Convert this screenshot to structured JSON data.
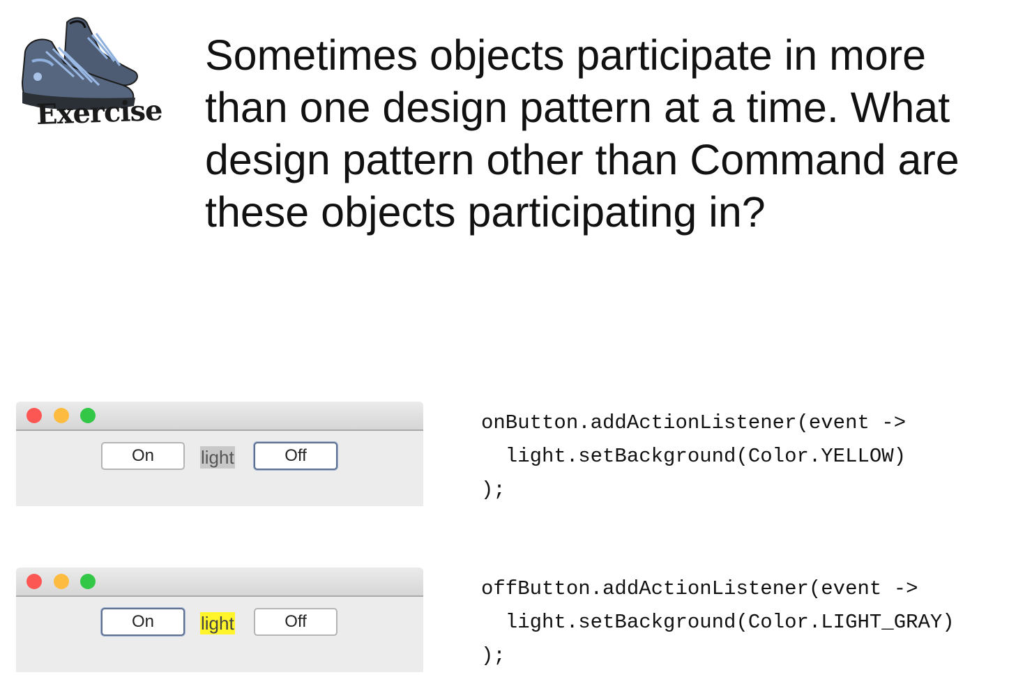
{
  "exercise": {
    "label": "Exercise",
    "icon": "sneakers-icon"
  },
  "question": "Sometimes objects participate in more than one design pattern at a time. What design pattern other than Command are these objects participating in?",
  "windows": [
    {
      "buttons": {
        "on": "On",
        "off": "Off"
      },
      "focused": "off",
      "light": {
        "text": "light",
        "background": "#c8c8c8"
      }
    },
    {
      "buttons": {
        "on": "On",
        "off": "Off"
      },
      "focused": "on",
      "light": {
        "text": "light",
        "background": "#fff52a"
      }
    }
  ],
  "colors": {
    "traffic_red": "#fc5753",
    "traffic_yellow": "#fdbc40",
    "traffic_green": "#33c748"
  },
  "code_snippets": [
    "onButton.addActionListener(event ->\n  light.setBackground(Color.YELLOW)\n);",
    "offButton.addActionListener(event ->\n  light.setBackground(Color.LIGHT_GRAY)\n);"
  ]
}
